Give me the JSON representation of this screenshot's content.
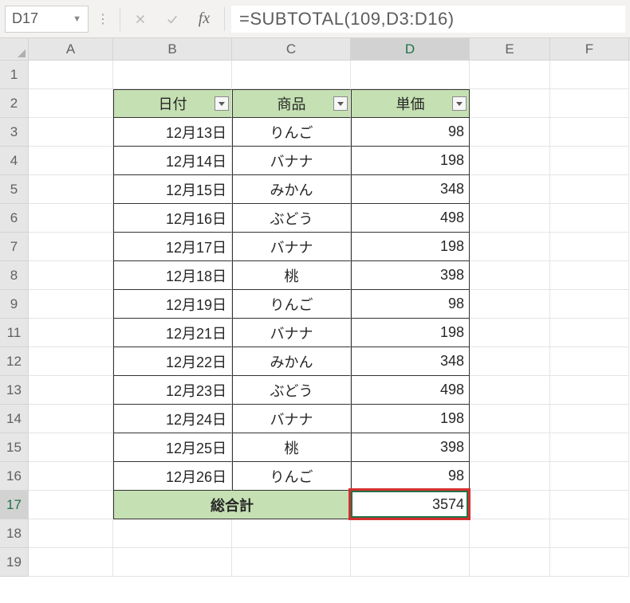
{
  "name_box": "D17",
  "formula": "=SUBTOTAL(109,D3:D16)",
  "columns": [
    "A",
    "B",
    "C",
    "D",
    "E",
    "F"
  ],
  "col_widths": {
    "A": 106,
    "B": 149,
    "C": 149,
    "D": 149,
    "E": 101,
    "F": 99
  },
  "selected_cell": "D17",
  "row_numbers": [
    1,
    2,
    3,
    4,
    5,
    6,
    7,
    8,
    9,
    11,
    12,
    13,
    14,
    15,
    16,
    17,
    18,
    19
  ],
  "headers": {
    "b": "日付",
    "c": "商品",
    "d": "単価"
  },
  "data": [
    {
      "b": "12月13日",
      "c": "りんご",
      "d": "98"
    },
    {
      "b": "12月14日",
      "c": "バナナ",
      "d": "198"
    },
    {
      "b": "12月15日",
      "c": "みかん",
      "d": "348"
    },
    {
      "b": "12月16日",
      "c": "ぶどう",
      "d": "498"
    },
    {
      "b": "12月17日",
      "c": "バナナ",
      "d": "198"
    },
    {
      "b": "12月18日",
      "c": "桃",
      "d": "398"
    },
    {
      "b": "12月19日",
      "c": "りんご",
      "d": "98"
    },
    {
      "b": "12月21日",
      "c": "バナナ",
      "d": "198"
    },
    {
      "b": "12月22日",
      "c": "みかん",
      "d": "348"
    },
    {
      "b": "12月23日",
      "c": "ぶどう",
      "d": "498"
    },
    {
      "b": "12月24日",
      "c": "バナナ",
      "d": "198"
    },
    {
      "b": "12月25日",
      "c": "桃",
      "d": "398"
    },
    {
      "b": "12月26日",
      "c": "りんご",
      "d": "98"
    }
  ],
  "footer": {
    "label": "総合計",
    "total": "3574"
  }
}
